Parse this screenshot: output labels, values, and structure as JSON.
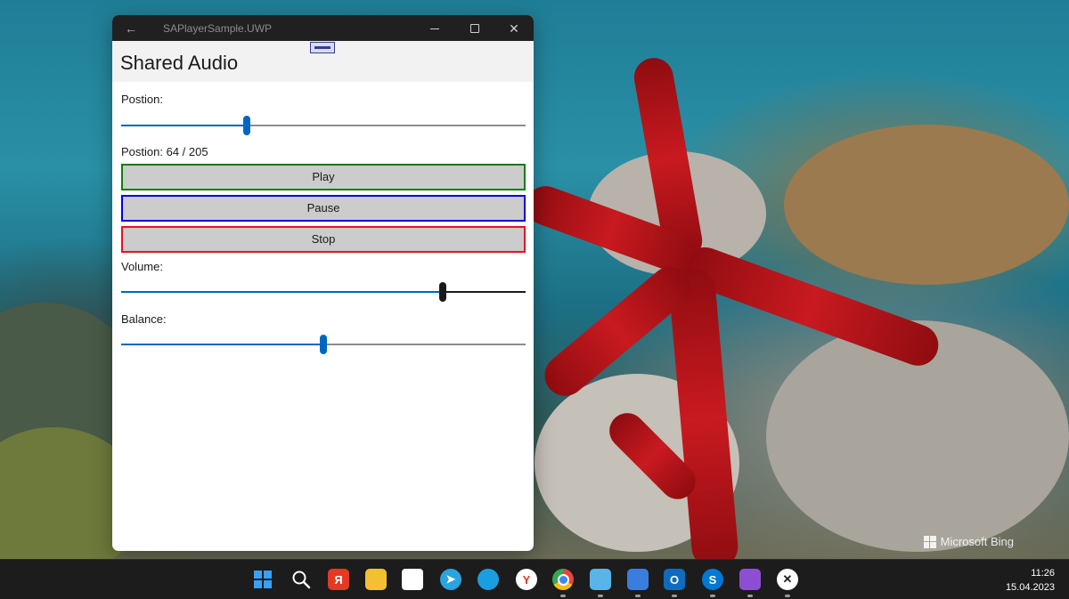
{
  "window": {
    "title": "SAPlayerSample.UWP",
    "back_glyph": "←",
    "close_glyph": "✕"
  },
  "app": {
    "header_title": "Shared Audio",
    "position_label": "Postion:",
    "position_slider_value": 0.31,
    "position_readout": "Postion: 64 / 205",
    "buttons": {
      "play": "Play",
      "pause": "Pause",
      "stop": "Stop"
    },
    "button_border_colors": {
      "play": "#107c10",
      "pause": "#0000e6",
      "stop": "#e81123"
    },
    "volume_label": "Volume:",
    "volume_slider_value": 0.795,
    "balance_label": "Balance:",
    "balance_slider_value": 0.5
  },
  "colors": {
    "accent": "#0067c0",
    "titlebar_bg": "#202020",
    "header_bg": "#f2f2f2"
  },
  "desktop": {
    "watermark": "Microsoft Bing"
  },
  "taskbar": {
    "icons": [
      {
        "name": "windows-start-icon",
        "glyph": "",
        "color": "#3aa0f3"
      },
      {
        "name": "search-icon",
        "glyph": "",
        "color": "transparent"
      },
      {
        "name": "yandex-browser-icon",
        "glyph": "Я",
        "color": "#e23a23"
      },
      {
        "name": "file-explorer-icon",
        "glyph": "",
        "color": "#f3c033"
      },
      {
        "name": "microsoft-store-icon",
        "glyph": "",
        "color": "#ffffff"
      },
      {
        "name": "telegram-icon",
        "glyph": "➤",
        "color": "#2aa3df"
      },
      {
        "name": "edge-icon",
        "glyph": "",
        "color": "#1b9de2"
      },
      {
        "name": "yandex-icon",
        "glyph": "Y",
        "color": "#ffffff"
      },
      {
        "name": "chrome-icon",
        "glyph": "",
        "color": "#e8453c"
      },
      {
        "name": "notepad-icon",
        "glyph": "",
        "color": "#5ab4e8"
      },
      {
        "name": "save-app-icon",
        "glyph": "",
        "color": "#3b7ddd"
      },
      {
        "name": "outlook-icon",
        "glyph": "O",
        "color": "#0f6cbd"
      },
      {
        "name": "skype-icon",
        "glyph": "S",
        "color": "#0078d4"
      },
      {
        "name": "visual-studio-icon",
        "glyph": "",
        "color": "#8c4fd1"
      },
      {
        "name": "xamarin-icon",
        "glyph": "✕",
        "color": "#ffffff"
      }
    ],
    "time": "11:26",
    "date": "15.04.2023"
  }
}
